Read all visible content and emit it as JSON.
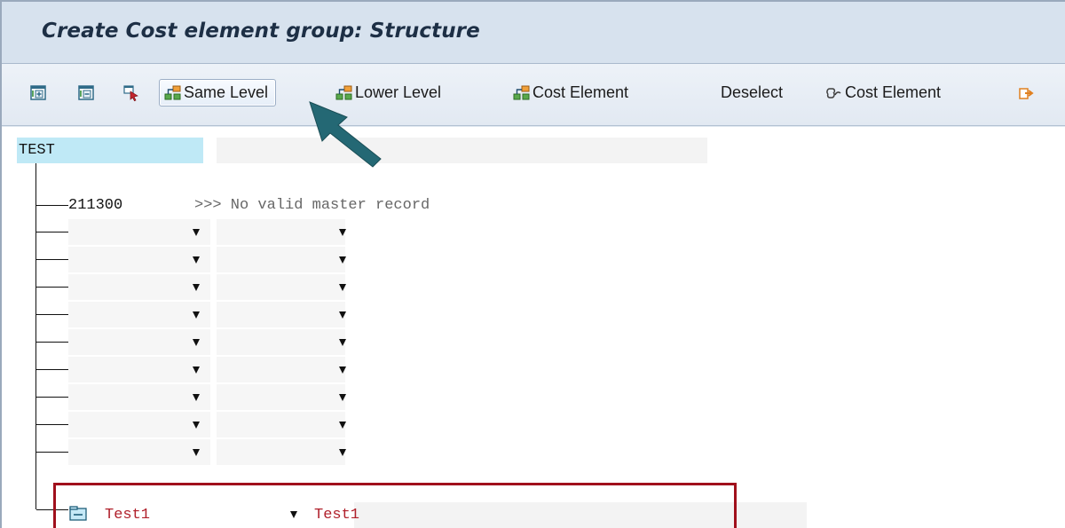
{
  "window": {
    "title": "Create Cost element group: Structure"
  },
  "toolbar": {
    "expand_all_icon": "expand-subtree-icon",
    "collapse_all_icon": "collapse-subtree-icon",
    "select_icon": "select-pointer-icon",
    "same_level_label": "Same Level",
    "lower_level_label": "Lower Level",
    "cost_element_label": "Cost Element",
    "deselect_label": "Deselect",
    "cost_element_2_label": "Cost Element",
    "more_icon": "transfer-arrow-icon"
  },
  "tree": {
    "root_label": "TEST",
    "first_item": {
      "value": "211300",
      "message": ">>> No valid master record"
    },
    "empty_rows": 9,
    "selected_item": {
      "group_value": "Test1",
      "description": "Test1"
    }
  },
  "annotation": {
    "highlight_color": "#a0101c",
    "arrow_color": "#246874"
  }
}
